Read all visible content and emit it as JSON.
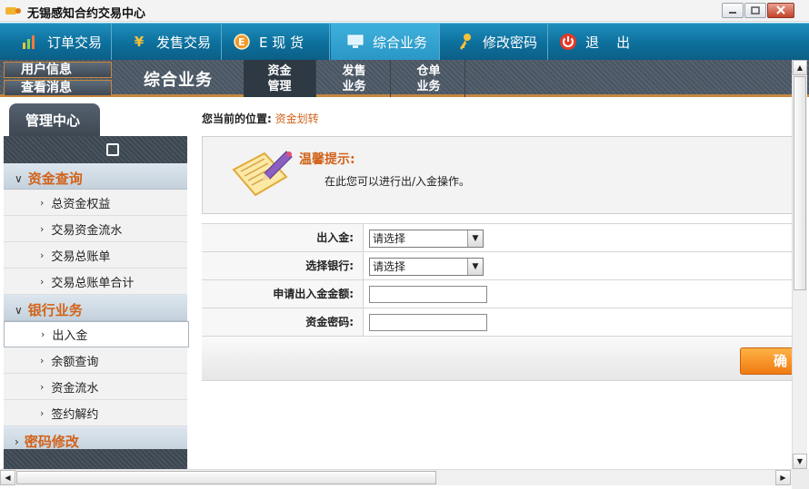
{
  "window": {
    "title": "无锡感知合约交易中心"
  },
  "topnav": {
    "items": [
      {
        "label": "订单交易",
        "icon": "bar-chart-icon",
        "active": false
      },
      {
        "label": "发售交易",
        "icon": "yen-icon",
        "active": false
      },
      {
        "label": "E 现 货",
        "icon": "e-coin-icon",
        "active": false
      },
      {
        "label": "综合业务",
        "icon": "monitor-icon",
        "active": true
      },
      {
        "label": "修改密码",
        "icon": "key-icon",
        "active": false
      },
      {
        "label": "退    出",
        "icon": "power-icon",
        "active": false
      }
    ]
  },
  "subnav": {
    "user_info": "用户信息",
    "messages": "查看消息",
    "section_title": "综合业务",
    "tabs": [
      {
        "line1": "资金",
        "line2": "管理",
        "active": true
      },
      {
        "line1": "发售",
        "line2": "业务",
        "active": false
      },
      {
        "line1": "仓单",
        "line2": "业务",
        "active": false
      }
    ]
  },
  "sidebar": {
    "tab_label": "管理中心",
    "groups": [
      {
        "label": "资金查询",
        "items": [
          "总资金权益",
          "交易资金流水",
          "交易总账单",
          "交易总账单合计"
        ]
      },
      {
        "label": "银行业务",
        "items": [
          "出入金",
          "余额查询",
          "资金流水",
          "签约解约"
        ]
      },
      {
        "label": "密码修改",
        "items": []
      }
    ],
    "selected_item": "出入金"
  },
  "main": {
    "location_label": "您当前的位置:",
    "location_value": "资金划转",
    "tip": {
      "title": "温馨提示:",
      "text": "在此您可以进行出/入金操作。"
    },
    "form": {
      "direction_label": "出入金:",
      "direction_value": "请选择",
      "bank_label": "选择银行:",
      "bank_value": "请选择",
      "amount_label": "申请出入金金额:",
      "amount_value": "",
      "password_label": "资金密码:",
      "password_value": "",
      "confirm_label": "确"
    }
  },
  "colors": {
    "nav_blue": "#0d6f9c",
    "accent_orange": "#d1631a",
    "subnav_gray": "#4a5562",
    "button_orange": "#f07a12"
  }
}
